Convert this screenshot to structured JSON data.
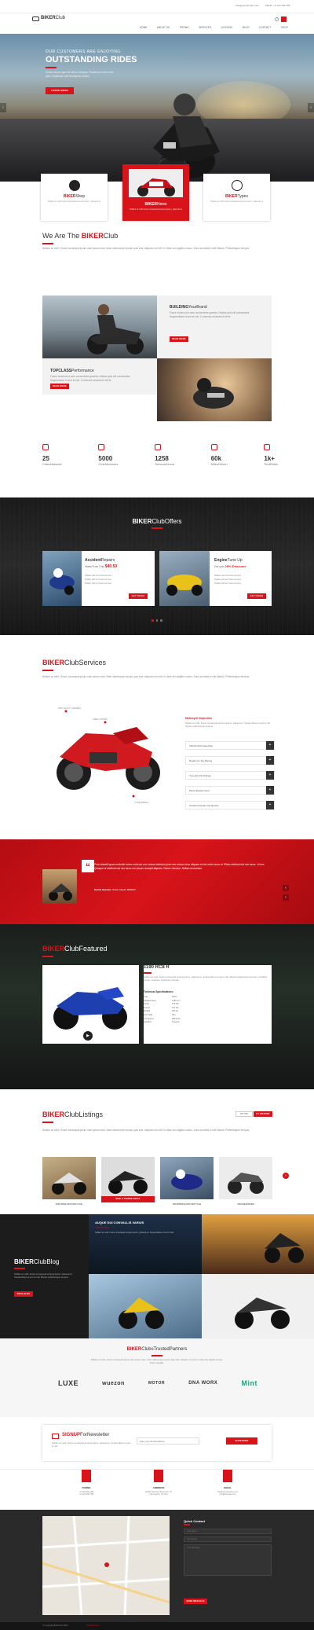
{
  "header": {
    "brand_bold": "BIKER",
    "brand_rest": "Club",
    "email": "info@yourdomain.com",
    "phone": "Mobile: +0 123 456 789",
    "nav": [
      "HOME",
      "ABOUT US",
      "PROMO",
      "SERVICES",
      "LISTINGS",
      "BLOG",
      "CONTACT",
      "SHOP"
    ]
  },
  "hero": {
    "small": "OUR CUSTOMERS ARE ENJOYING",
    "big": "OUTSTANDING RIDES",
    "text": "Donec accuis aget intl ultrices tempus. Phasellus et sem eros quis. Vestibulum sed la aliquam consec.",
    "button": "LEARN MORE"
  },
  "cards": [
    {
      "bold": "BIKER",
      "rest": "Shop",
      "text": "Nullam ac velit fusce consequat tempus ipsum, placerat et"
    },
    {
      "bold": "BIKER",
      "rest": "News",
      "text": "Nullam ac velit fusce consequat tempus ipsum, placerat et"
    },
    {
      "bold": "BIKER",
      "rest": "Types",
      "text": "Nullam ac velit fusce consequat tempus ipsum, placerat et"
    }
  ],
  "about": {
    "title_pre": "We Are The ",
    "title_bold": "BIKER",
    "title_rest": "Club",
    "text": "Nullam ac velit. Fusce consequat ipsum nam ipsum nam. Nam ullamcorper ipsum quis erat. Aliquam non elit. In vitae dui sagittis cursus. Duis convallis in nisl Mauris. Pellentesque tempus.",
    "b1_bold": "BUILDING",
    "b1_rest": "YourBrand",
    "b1_text": "Fusce euismod ut sem consectetur gravida. Nullam quis elit consectetur. Suspendisse et sed et nisl. Commodo sit amet id elit et.",
    "b1_btn": "READ MORE",
    "b2_bold": "TOPCLASS",
    "b2_rest": "Performance",
    "b2_text": "Fusce euismod ut sem consectetur gravida. Nullam quis elit consectetur. Suspendisse et sed et nisl. Commodo sit amet id elit et.",
    "b2_btn": "READ MORE"
  },
  "stats": [
    {
      "n": "25",
      "l": "CitiesNetwork"
    },
    {
      "n": "5000",
      "l": "ClubMembers"
    },
    {
      "n": "1258",
      "l": "ServicesDone"
    },
    {
      "n": "60k",
      "l": "MilesDriven"
    },
    {
      "n": "1k+",
      "l": "TestRides"
    }
  ],
  "offers": {
    "title_bold": "BIKER",
    "title_rest": "ClubOffers",
    "o1_bold": "Accident",
    "o1_rest": "Repairs",
    "o1_price_pre": "Starts From Only ",
    "o1_price": "$40.50",
    "o2_bold": "Engine",
    "o2_rest": "Tune Up",
    "o2_price_pre": "Get upto ",
    "o2_price": "25% Discount",
    "bullets": [
      "Nullam velit ac Fusce tempus",
      "Nullam velit ac Fusce tempus",
      "Nullam velit ac Fusce tempus"
    ],
    "btn": "GET OFFER"
  },
  "services": {
    "title_bold": "BIKER",
    "title_rest": "ClubServices",
    "text": "Nullam ac velit. Fusce consequat ipsum nam ipsum nam. Nam ullamcorper ipsum quis erat. Aliquam non elit. In vitae dui sagittis cursus. Duis convallis in nisl Mauris. Pellentesque tempus.",
    "label1": "HIGH QUALITY FENDERS",
    "label2": "STEEL CHASSIS",
    "label3": "TUNE WHEELS",
    "first_title": "Motorcycle Inspection",
    "first_text": "Nullam ac velit. Fusce consequat tempus ipsum, placerat et. Suspendisse et sed et nisl. Mauris pellentesque tempus.",
    "items": [
      "Vehicle Roll Inspection",
      "Ready For the Racing",
      "Tyre And Oil Change",
      "Parts Replacement",
      "Accident Repair And Quotes"
    ]
  },
  "quote": {
    "text": "Proin blandit quam molestie luctus vehicula orci massa interdum justo nec rutrum risus aliquam et nisl vehic lacus et. Etiam eleifend nisl nec lacus. Ut nec. Quisque at eleifend nisl nec lacus non ipsum suscipit aliquam. Donec rhoncus. Nullam accumsan.",
    "author": "Martha Newman",
    "role": "Owner Classic BMW/24"
  },
  "featured": {
    "title_bold": "BIKER",
    "title_rest": "ClubFeatured",
    "bike": "1190 RC8 R",
    "text": "Nullam ac velit. Fusce consequat tempus ipsum, placerat et. Suspendisse et sed et nisl. Mauris pellentesque tempus. Curabitur vel leo. Vivamus. Vestibulum feugiat.",
    "spec_title": "Technical Specifications:",
    "specs": [
      [
        "Year",
        "2015"
      ],
      [
        "Displacement",
        "1195 cm³"
      ],
      [
        "Power",
        "175 HP"
      ],
      [
        "Torque",
        "127 Nm"
      ],
      [
        "Weight",
        "182 kg"
      ],
      [
        "Fuel Tank",
        "18 L"
      ],
      [
        "Top Speed",
        "290 km/h"
      ],
      [
        "Gearbox",
        "6-speed"
      ]
    ]
  },
  "listings": {
    "title_bold": "BIKER",
    "title_rest": "ClubListings",
    "text": "Nullam ac velit. Fusce consequat ipsum nam ipsum nam. Nam ullamcorper ipsum quis erat. Aliquam non elit. In vitae dui sagittis cursus. Duis convallis in nisl Mauris. Pellentesque tempus.",
    "tab1": "ON TOP",
    "tab2": "BY BRANDS",
    "items": [
      "DIRT BIKE MOTORCYCLE",
      "NEW & POWER BIKES",
      "SPORTBIKE MOTORCYCLE",
      "CRUISER BIKES"
    ]
  },
  "blog": {
    "title_bold": "BIKER",
    "title_rest": "ClubBlog",
    "text": "Nullam ac velit. Fusce consequat tempus ipsum, placerat et. Suspendisse et sed et nisl. Mauris pellentesque tempus.",
    "btn": "VIEW BLOG",
    "post_title": "AUQUE DUI CONVALLIS VARIUS",
    "post_date": "JUNE 24, 2016",
    "post_text": "Nullam ac velit. Fusce consequat tempus ipsum, placerat et. Suspendisse et sed et nisl."
  },
  "partners": {
    "title_bold": "BIKER",
    "title_rest": "ClubsTrustedPartners",
    "text": "Nullam ac velit. Fusce consequat ipsum nam ipsum nam. Nam ullamcorper ipsum quis erat. Aliquam non elit. In vitae dui sagittis cursus. Duis convallis.",
    "logos": [
      "LUXE",
      "wuezon",
      "MOTOR",
      "DNA WORX",
      "Mint"
    ]
  },
  "newsletter": {
    "bold": "SIGNUP",
    "rest": "ForNewsletter",
    "text": "Nullam ac velit. Fusce consequat tempus ipsum, placerat et. Suspendisse et sed et nisl.",
    "placeholder": "Enter your Email Address",
    "btn": "SUBSCRIBE"
  },
  "contact": [
    {
      "label": "PHONE",
      "l1": "+0 123 456 789",
      "l2": "+0 123 456 789"
    },
    {
      "label": "ADDRESS",
      "l1": "NCAP Discount Street No. 57",
      "l2": "Farmington, CA 234"
    },
    {
      "label": "EMAIL",
      "l1": "info@yourdomain.com",
      "l2": "info@domain.com"
    }
  ],
  "footer": {
    "quick": "Quick Contact",
    "name_ph": "Your Name",
    "email_ph": "Your Email",
    "msg_ph": "Your Message",
    "btn": "SEND MESSAGE",
    "copy": "© Copyright BikerClub 2016",
    "credit": "ThemeForest"
  },
  "colors": {
    "accent": "#d8141a",
    "dark": "#1e1e1e"
  }
}
